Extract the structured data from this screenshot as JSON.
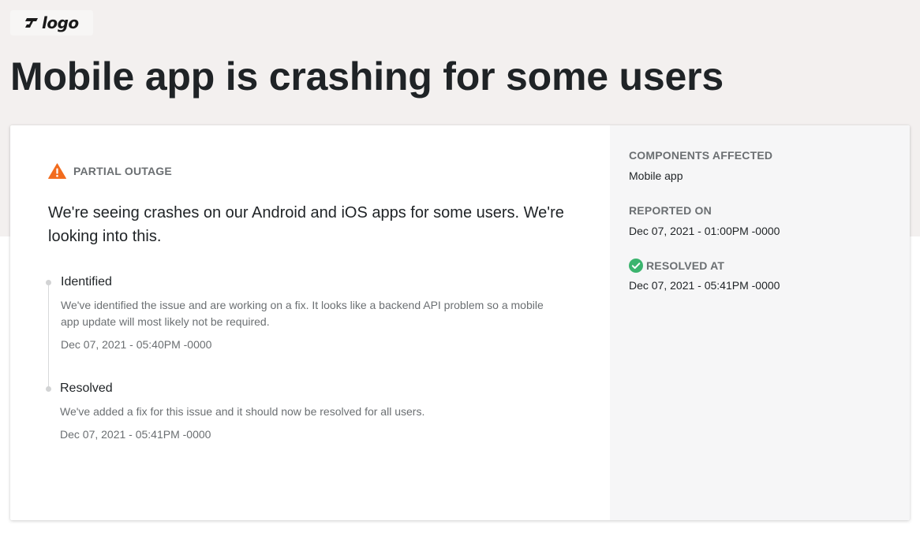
{
  "header": {
    "logo_text": "logo",
    "title": "Mobile app is crashing for some users"
  },
  "incident": {
    "status": "PARTIAL OUTAGE",
    "status_icon": "warning-triangle-icon",
    "status_color": "#f26b1d",
    "summary": "We're seeing crashes on our Android and iOS apps for some users. We're looking into this."
  },
  "updates": [
    {
      "title": "Identified",
      "body": "We've identified the issue and are working on a fix. It looks like a backend API problem so a mobile app update will most likely not be required.",
      "time": "Dec 07, 2021 - 05:40PM -0000"
    },
    {
      "title": "Resolved",
      "body": "We've added a fix for this issue and it should now be resolved for all users.",
      "time": "Dec 07, 2021 - 05:41PM -0000"
    }
  ],
  "sidebar": {
    "components": {
      "label": "COMPONENTS AFFECTED",
      "value": "Mobile app"
    },
    "reported": {
      "label": "REPORTED ON",
      "value": "Dec 07, 2021 - 01:00PM -0000"
    },
    "resolved": {
      "label": "RESOLVED AT",
      "value": "Dec 07, 2021 - 05:41PM -0000",
      "icon": "check-circle-icon",
      "icon_color": "#3bb46e"
    }
  },
  "colors": {
    "header_band": "#f3f0ef",
    "sidebar_bg": "#f6f6f7"
  }
}
